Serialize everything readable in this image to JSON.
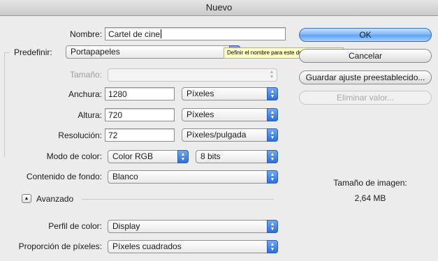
{
  "window": {
    "title": "Nuevo"
  },
  "form": {
    "nombre_label": "Nombre:",
    "nombre_value": "Cartel de cine",
    "predefinir_label": "Predefinir:",
    "predefinir_value": "Portapapeles",
    "tamano_label": "Tamaño:",
    "tamano_value": "",
    "anchura_label": "Anchura:",
    "anchura_value": "1280",
    "anchura_unit": "Píxeles",
    "altura_label": "Altura:",
    "altura_value": "720",
    "altura_unit": "Píxeles",
    "resolucion_label": "Resolución:",
    "resolucion_value": "72",
    "resolucion_unit": "Píxeles/pulgada",
    "modo_label": "Modo de color:",
    "modo_value": "Color RGB",
    "bits_value": "8 bits",
    "fondo_label": "Contenido de fondo:",
    "fondo_value": "Blanco",
    "avanzado_label": "Avanzado",
    "perfil_label": "Perfil de color:",
    "perfil_value": "Display",
    "proporcion_label": "Proporción de píxeles:",
    "proporcion_value": "Píxeles cuadrados"
  },
  "tooltip": {
    "text": "Definir el nombre para este documento nuevo"
  },
  "buttons": {
    "ok": "OK",
    "cancel": "Cancelar",
    "save_preset": "Guardar ajuste preestablecido...",
    "delete_preset": "Eliminar valor..."
  },
  "image_size": {
    "label": "Tamaño de imagen:",
    "value": "2,64 MB"
  },
  "icons": {
    "disclosure": "disclosure-up-icon",
    "select_arrows": "updown-arrows-icon"
  }
}
